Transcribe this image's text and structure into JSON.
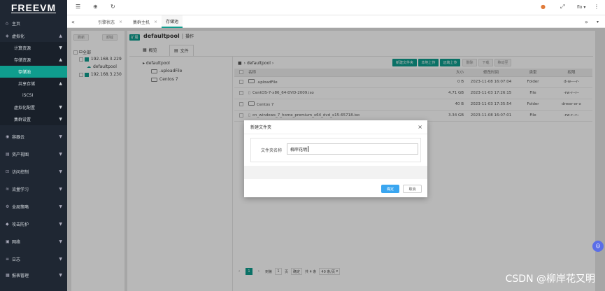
{
  "logo": "FREEVM",
  "sidebar": {
    "items": [
      {
        "label": "主页"
      },
      {
        "label": "虚拟化"
      },
      {
        "label": "计算资源"
      },
      {
        "label": "存储资源"
      },
      {
        "label": "存储池"
      },
      {
        "label": "共享存储"
      },
      {
        "label": "iSCSI"
      },
      {
        "label": "虚拟化配置"
      },
      {
        "label": "集群设置"
      },
      {
        "label": "容器云"
      },
      {
        "label": "资产视图"
      },
      {
        "label": "访问控制"
      },
      {
        "label": "流量学习"
      },
      {
        "label": "全局策略"
      },
      {
        "label": "攻击防护"
      },
      {
        "label": "网络"
      },
      {
        "label": "日志"
      },
      {
        "label": "报表管理"
      }
    ]
  },
  "topbar": {
    "user": "flo"
  },
  "tabs": [
    {
      "label": "引擎状态"
    },
    {
      "label": "集群主机"
    },
    {
      "label": "存储池"
    }
  ],
  "left_panel": {
    "btn1": "刷新",
    "btn2": "卸载",
    "tree": {
      "root": "全部",
      "host1": "192.168.3.229",
      "pool": "defaultpool",
      "host2": "192.168.3.230"
    }
  },
  "pool_header": {
    "expand": "扩展",
    "name": "defaultpool",
    "sep": "|",
    "op": "操作"
  },
  "view_tabs": {
    "overview": "概览",
    "files": "文件"
  },
  "dir_tree": {
    "root": "defaultpool",
    "children": [
      ".uploadFile",
      "Centos 7"
    ]
  },
  "path": "defaultpool",
  "toolbar": {
    "new_folder": "新建文件夹",
    "local_upload": "本地上传",
    "remote_upload": "远端上传",
    "delete": "删除",
    "download": "下载",
    "move": "移动至"
  },
  "table": {
    "headers": [
      "名称",
      "大小",
      "修改时间",
      "类型",
      "权限"
    ],
    "rows": [
      {
        "name": ".uploadFile",
        "size": "0 B",
        "time": "2023-11-08 16:07:04",
        "type": "Folder",
        "perm": "d-w----r-"
      },
      {
        "name": "CentOS-7-x86_64-DVD-2009.iso",
        "size": "4.71 GB",
        "time": "2023-11-03 17:26:15",
        "type": "File",
        "perm": "-rw-r--r--"
      },
      {
        "name": "Centos 7",
        "size": "40 B",
        "time": "2023-11-03 17:35:54",
        "type": "Folder",
        "perm": "drwxr-xr-x"
      },
      {
        "name": "cn_windows_7_home_premium_x64_dvd_x15-65718.iso",
        "size": "3.34 GB",
        "time": "2023-11-08 16:07:01",
        "type": "File",
        "perm": "-rw-r--r--"
      }
    ]
  },
  "pager": {
    "page": "1",
    "goto": "到第",
    "page_input": "1",
    "page_unit": "页",
    "confirm": "确定",
    "total": "共 4 条",
    "per_page": "40 条/页"
  },
  "dialog": {
    "title": "新建文件夹",
    "field_label": "文件夹名称",
    "field_value": "柳岸花明",
    "ok": "确定",
    "cancel": "取消"
  },
  "watermark": "CSDN @柳岸花又明",
  "colors": {
    "accent": "#0f9d8e",
    "sidebar": "#1f2733",
    "primary_btn": "#3aa6f0"
  }
}
